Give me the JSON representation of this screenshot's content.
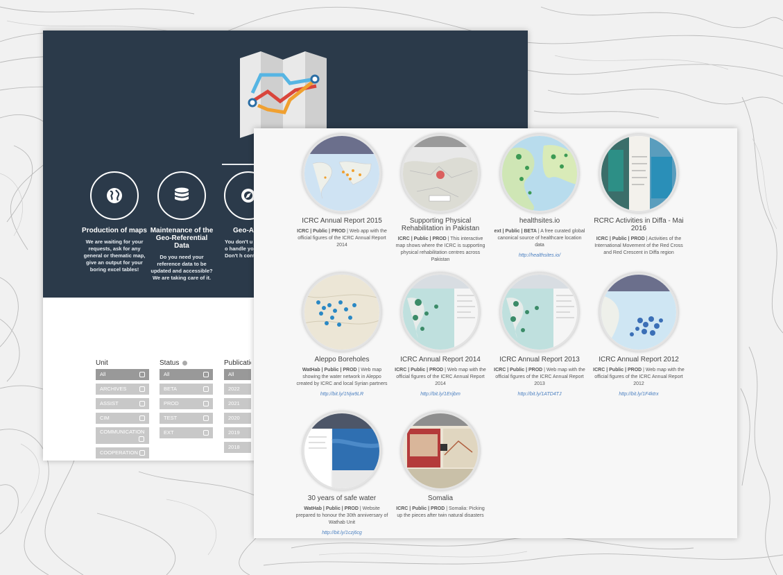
{
  "services": [
    {
      "title": "Production of maps",
      "desc": "We are waiting for your requests, ask for any general or thematic map, give an output for your boring excel tables!"
    },
    {
      "title": "Maintenance of the Geo-Referential Data",
      "desc": "Do you need your reference data to be updated and accessible? We are taking care of it."
    },
    {
      "title": "Geo-A",
      "desc": "You don't u your maps o handle your g data? Don't h contact us !"
    }
  ],
  "filters": {
    "unit": {
      "label": "Unit",
      "items": [
        "All",
        "ARCHIVES",
        "ASSIST",
        "CIM",
        "COMMUNICATION",
        "COOPERATION"
      ]
    },
    "status": {
      "label": "Status",
      "items": [
        "All",
        "BETA",
        "PROD",
        "TEST",
        "EXT"
      ]
    },
    "publication": {
      "label": "Publicatio",
      "items": [
        "All",
        "2022",
        "2021",
        "2020",
        "2019",
        "2018"
      ]
    }
  },
  "cards": [
    {
      "title": "ICRC Annual Report 2015",
      "tags": "ICRC | Public | PROD",
      "desc": " | Web app with the official figures of the ICRC Annual Report 2014",
      "link": ""
    },
    {
      "title": "Supporting Physical Rehabilitation in Pakistan",
      "tags": "ICRC | Public | PROD",
      "desc": " | This interactive map shows where the ICRC is supporting physical rehabilitation centres across Pakistan",
      "link": ""
    },
    {
      "title": "healthsites.io",
      "tags": "ext | Public | BETA",
      "desc": " | A free curated global canonical source of healthcare location data",
      "link": "http://healthsites.io/"
    },
    {
      "title": "RCRC Activities in Diffa - Mai 2016",
      "tags": "ICRC | Public | PROD",
      "desc": " | Activities of the International Movement of the Red Cross and Red Crescent in Diffa region",
      "link": ""
    },
    {
      "title": "Aleppo Boreholes",
      "tags": "WatHab | Public | PROD",
      "desc": " | Web map showing the water network in Aleppo created by ICRC and local Syrian partners",
      "link": "http://bit.ly/1Njw9LR"
    },
    {
      "title": "ICRC Annual Report 2014",
      "tags": "ICRC | Public | PROD",
      "desc": " | Web map with the official figures of the ICRC Annual Report 2014",
      "link": "http://bit.ly/1Erijbm"
    },
    {
      "title": "ICRC Annual Report 2013",
      "tags": "ICRC | Public | PROD",
      "desc": " | Web map with the official figures of the ICRC Annual Report 2013",
      "link": "http://bit.ly/1ATD4TJ"
    },
    {
      "title": "ICRC Annual Report 2012",
      "tags": "ICRC | Public | PROD",
      "desc": " | Web map with the official figures of the ICRC Annual Report 2012",
      "link": "http://bit.ly/1F4ktrx"
    },
    {
      "title": "30 years of safe water",
      "tags": "WatHab | Public | PROD",
      "desc": " | Website prepared to honour the 30th anniversary of Wathab Unit",
      "link": "http://bit.ly/1czj6cg"
    },
    {
      "title": "Somalia",
      "tags": "ICRC | Public | PROD",
      "desc": " | Somalia: Picking up the pieces after twin natural disasters",
      "link": ""
    }
  ],
  "colors": {
    "hero": "#2b3a4a",
    "link": "#4a7fc0",
    "logo_blue": "#56b5e3",
    "logo_red": "#d9453b",
    "logo_orange": "#f0a030"
  }
}
